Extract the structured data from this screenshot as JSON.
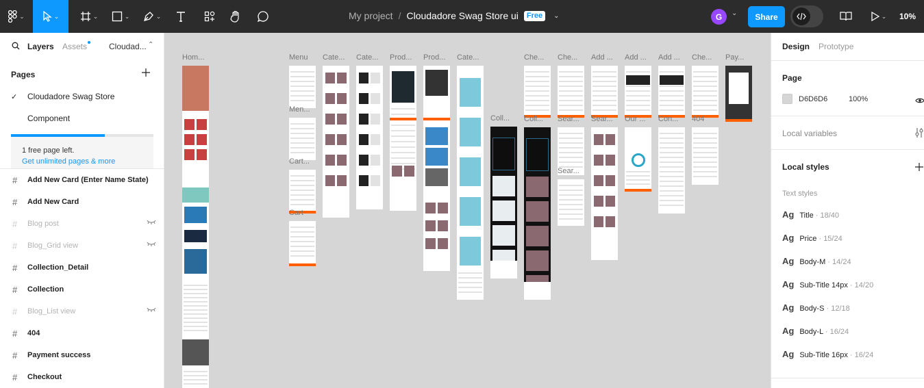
{
  "toolbar": {
    "project": "My project",
    "separator": "/",
    "file_name": "Cloudadore Swag Store ui",
    "plan_badge": "Free",
    "avatar_initial": "G",
    "share_label": "Share",
    "zoom": "10%",
    "accent": "#0d99ff",
    "icons": [
      "figma-menu-icon",
      "move-tool-icon",
      "frame-tool-icon",
      "shape-tool-icon",
      "pen-tool-icon",
      "text-tool-icon",
      "resources-icon",
      "hand-tool-icon",
      "comment-icon",
      "dev-mode-icon",
      "library-icon",
      "present-icon"
    ]
  },
  "left_panel": {
    "tabs": {
      "layers": "Layers",
      "assets": "Assets",
      "file": "Cloudad..."
    },
    "pages_heading": "Pages",
    "pages": [
      {
        "label": "Cloudadore Swag Store",
        "current": true
      },
      {
        "label": "Component",
        "current": false
      }
    ],
    "promo": {
      "text": "1 free page left.",
      "link": "Get unlimited pages & more",
      "progress": 0.66
    },
    "layers": [
      {
        "label": "Add New Card (Enter Name State)",
        "hidden": false
      },
      {
        "label": "Add New Card",
        "hidden": false
      },
      {
        "label": "Blog post",
        "hidden": true
      },
      {
        "label": "Blog_Grid view",
        "hidden": true
      },
      {
        "label": "Collection_Detail",
        "hidden": false
      },
      {
        "label": "Collection",
        "hidden": false
      },
      {
        "label": "Blog_List view",
        "hidden": true
      },
      {
        "label": "404",
        "hidden": false
      },
      {
        "label": "Payment success",
        "hidden": false
      },
      {
        "label": "Checkout",
        "hidden": false
      }
    ]
  },
  "right_panel": {
    "tabs": {
      "design": "Design",
      "prototype": "Prototype"
    },
    "page_heading": "Page",
    "page_color": "D6D6D6",
    "page_opacity": "100%",
    "local_variables": "Local variables",
    "local_styles": "Local styles",
    "text_styles_heading": "Text styles",
    "text_styles": [
      {
        "name": "Title",
        "meta": "18/40"
      },
      {
        "name": "Price",
        "meta": "15/24"
      },
      {
        "name": "Body-M",
        "meta": "14/24"
      },
      {
        "name": "Sub-Title 14px",
        "meta": "14/20"
      },
      {
        "name": "Body-S",
        "meta": "12/18"
      },
      {
        "name": "Body-L",
        "meta": "16/24"
      },
      {
        "name": "Sub-Title 16px",
        "meta": "16/24"
      }
    ]
  },
  "canvas": {
    "background": "#d6d6d6",
    "frame_labels": [
      "Hom...",
      "Menu",
      "Men...",
      "Cart...",
      "Cart",
      "Cate...",
      "Cate...",
      "Prod...",
      "Prod...",
      "Cate...",
      "Coll...",
      "Che...",
      "Coll...",
      "Che...",
      "Sear...",
      "Sear...",
      "Add ...",
      "Sear...",
      "Add ...",
      "Our ...",
      "Add ...",
      "Con...",
      "Che...",
      "404",
      "Pay..."
    ]
  }
}
